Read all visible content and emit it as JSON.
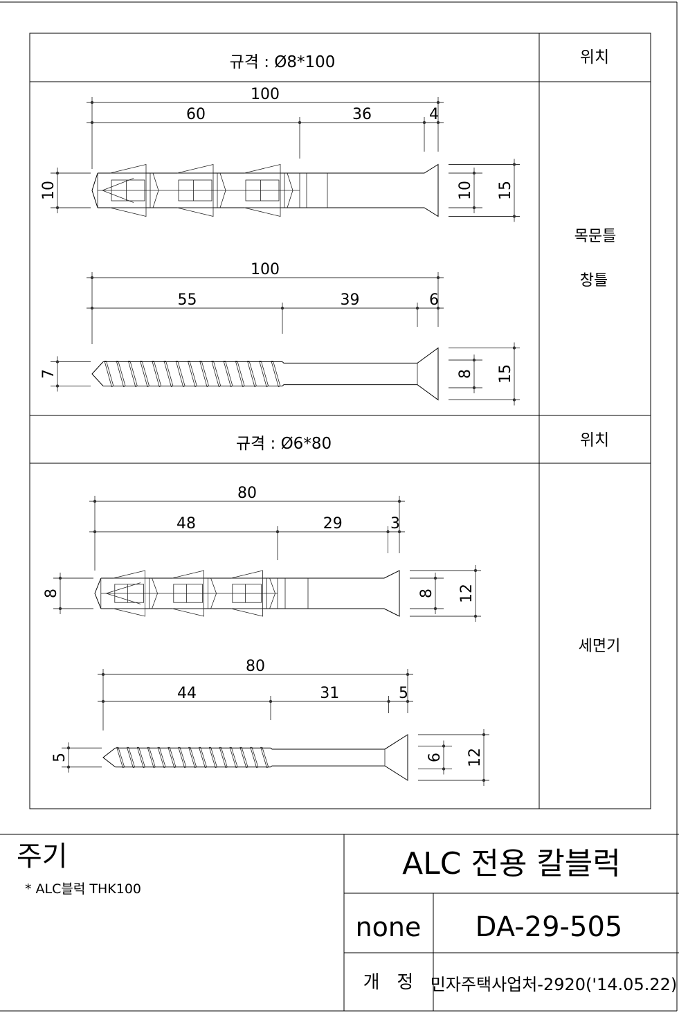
{
  "sections": [
    {
      "spec": "규격 : Ø8*100",
      "location_header": "위치",
      "locations": [
        "목문틀",
        "창틀"
      ],
      "drawings": [
        {
          "type": "anchor",
          "total": "100",
          "parts": [
            "60",
            "36",
            "4"
          ],
          "partValues": [
            60,
            36,
            4
          ],
          "totalValue": 100,
          "left": "10",
          "leftValue": 10,
          "right": [
            "10",
            "15"
          ],
          "rightValues": [
            10,
            15
          ]
        },
        {
          "type": "screw",
          "total": "100",
          "parts": [
            "55",
            "39",
            "6"
          ],
          "partValues": [
            55,
            39,
            6
          ],
          "totalValue": 100,
          "left": "7",
          "leftValue": 7,
          "right": [
            "8",
            "15"
          ],
          "rightValues": [
            8,
            15
          ]
        }
      ]
    },
    {
      "spec": "규격 : Ø6*80",
      "location_header": "위치",
      "locations": [
        "세면기"
      ],
      "drawings": [
        {
          "type": "anchor",
          "total": "80",
          "parts": [
            "48",
            "29",
            "3"
          ],
          "partValues": [
            48,
            29,
            3
          ],
          "totalValue": 80,
          "left": "8",
          "leftValue": 8,
          "right": [
            "8",
            "12"
          ],
          "rightValues": [
            8,
            12
          ]
        },
        {
          "type": "screw",
          "total": "80",
          "parts": [
            "44",
            "31",
            "5"
          ],
          "partValues": [
            44,
            31,
            5
          ],
          "totalValue": 80,
          "left": "5",
          "leftValue": 5,
          "right": [
            "6",
            "12"
          ],
          "rightValues": [
            6,
            12
          ]
        }
      ]
    }
  ],
  "notes": {
    "title": "주기",
    "items": [
      "* ALC블럭 THK100"
    ]
  },
  "title_block": {
    "title": "ALC 전용 칼블럭",
    "scale": "none",
    "drawing_no": "DA-29-505",
    "revision_label": "개   정",
    "revision": "민자주택사업처-2920('14.05.22)"
  }
}
